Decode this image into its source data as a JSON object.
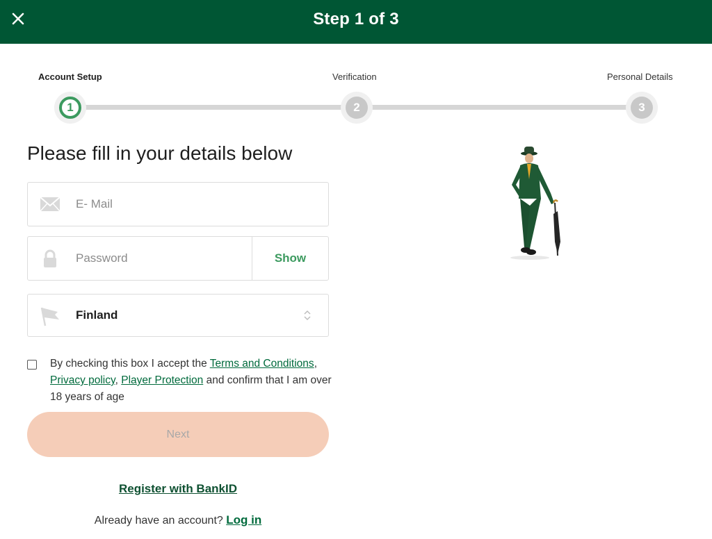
{
  "header": {
    "title": "Step 1 of 3",
    "close_icon": "close-icon"
  },
  "steps": [
    {
      "number": "1",
      "label": "Account Setup",
      "active": true
    },
    {
      "number": "2",
      "label": "Verification",
      "active": false
    },
    {
      "number": "3",
      "label": "Personal Details",
      "active": false
    }
  ],
  "form": {
    "heading": "Please fill in your details below",
    "email": {
      "placeholder": "E- Mail",
      "value": "",
      "icon": "envelope-icon"
    },
    "password": {
      "placeholder": "Password",
      "value": "",
      "icon": "lock-icon",
      "show_label": "Show"
    },
    "country": {
      "value": "Finland",
      "icon": "flag-icon"
    },
    "consent": {
      "checked": false,
      "text_before": "By checking this box I accept the ",
      "terms_link": "Terms and Conditions",
      "sep1": ", ",
      "privacy_link": "Privacy policy",
      "sep2": ", ",
      "protection_link": "Player Protection",
      "text_after": " and confirm that I am over 18 years of age"
    },
    "next_label": "Next",
    "bankid_label": "Register with BankID",
    "login_prompt": "Already have an account?",
    "login_label": "Log in"
  },
  "colors": {
    "brand_green": "#005634",
    "accent_green": "#3c9a5f",
    "next_disabled": "#f5cdb8"
  }
}
